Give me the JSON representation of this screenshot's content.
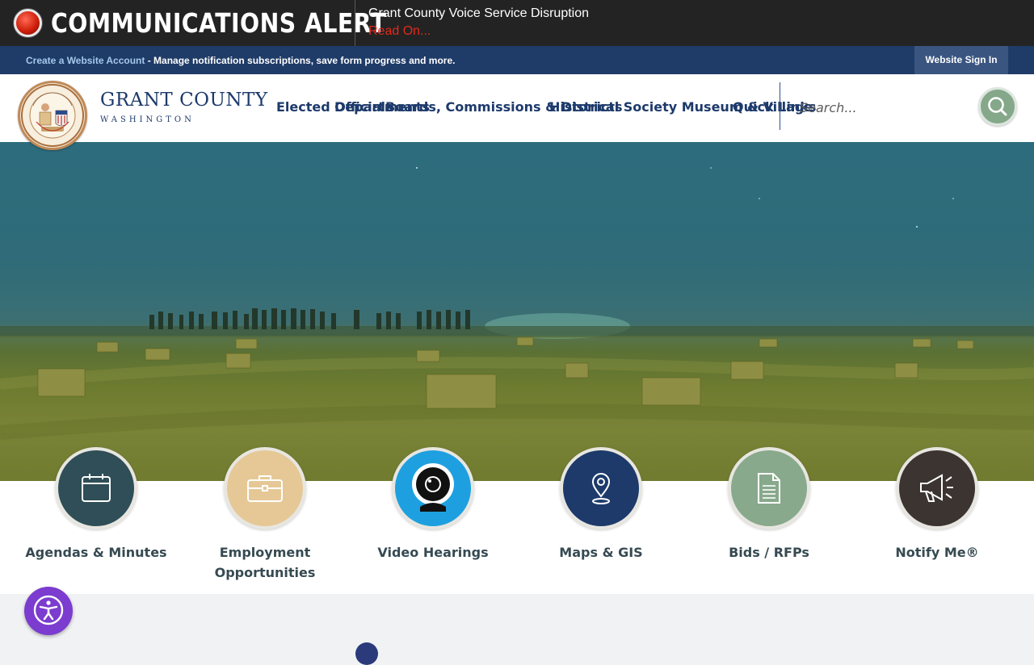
{
  "alert": {
    "title": "COMMUNICATIONS ALERT",
    "message": "Grant County Voice Service Disruption",
    "link": "Read On...",
    "dot_color": "#d0200c"
  },
  "account_bar": {
    "create_link": "Create a Website Account",
    "description": " - Manage notification subscriptions, save form progress and more.",
    "signin": "Website Sign In"
  },
  "header": {
    "logo_name": "GRANT COUNTY",
    "logo_sub": "WASHINGTON",
    "nav": [
      "Elected Officials",
      "Departments",
      "Boards, Commissions & Districts",
      "Historical Society Museum & Village",
      "Quick Links"
    ],
    "search_placeholder": "Search...",
    "search_icon": "search-icon"
  },
  "quick_links": [
    {
      "label": "Agendas & Minutes",
      "icon": "calendar-icon",
      "color": "#2f4e57"
    },
    {
      "label": "Employment Opportunities",
      "icon": "briefcase-icon",
      "color": "#e5c896"
    },
    {
      "label": "Video Hearings",
      "icon": "webcam-icon",
      "color": "#1ea0e0"
    },
    {
      "label": "Maps & GIS",
      "icon": "map-pin-icon",
      "color": "#1d3a6b"
    },
    {
      "label": "Bids / RFPs",
      "icon": "document-icon",
      "color": "#88a98c"
    },
    {
      "label": "Notify Me®",
      "icon": "megaphone-icon",
      "color": "#3b3431"
    }
  ],
  "accessibility": {
    "icon": "accessibility-icon",
    "color": "#7b3ccf"
  }
}
